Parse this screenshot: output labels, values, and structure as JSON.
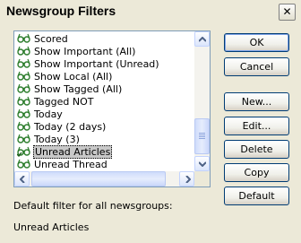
{
  "window": {
    "title": "Newsgroup Filters",
    "close_glyph": "✕"
  },
  "filters": [
    {
      "label": "Scored",
      "icon": "glasses-icon",
      "selected": false
    },
    {
      "label": "Show Important (All)",
      "icon": "glasses-icon",
      "selected": false
    },
    {
      "label": "Show Important (Unread)",
      "icon": "glasses-icon",
      "selected": false
    },
    {
      "label": "Show Local (All)",
      "icon": "glasses-icon",
      "selected": false
    },
    {
      "label": "Show Tagged (All)",
      "icon": "glasses-icon",
      "selected": false
    },
    {
      "label": "Tagged NOT",
      "icon": "glasses-icon",
      "selected": false
    },
    {
      "label": "Today",
      "icon": "glasses-icon",
      "selected": false
    },
    {
      "label": "Today (2 days)",
      "icon": "glasses-icon",
      "selected": false
    },
    {
      "label": "Today (3)",
      "icon": "glasses-icon",
      "selected": false
    },
    {
      "label": "Unread Articles",
      "icon": "glasses-check-icon",
      "selected": true
    },
    {
      "label": "Unread Thread",
      "icon": "glasses-icon",
      "selected": false
    }
  ],
  "buttons": {
    "ok": "OK",
    "cancel": "Cancel",
    "new": "New...",
    "edit": "Edit...",
    "delete": "Delete",
    "copy": "Copy",
    "default": "Default"
  },
  "default_filter": {
    "caption": "Default filter for all newsgroups:",
    "value": "Unread Articles"
  },
  "colors": {
    "dialog_bg": "#ece9d8",
    "list_border": "#7f9db9",
    "icon": "#2c7d2c"
  }
}
